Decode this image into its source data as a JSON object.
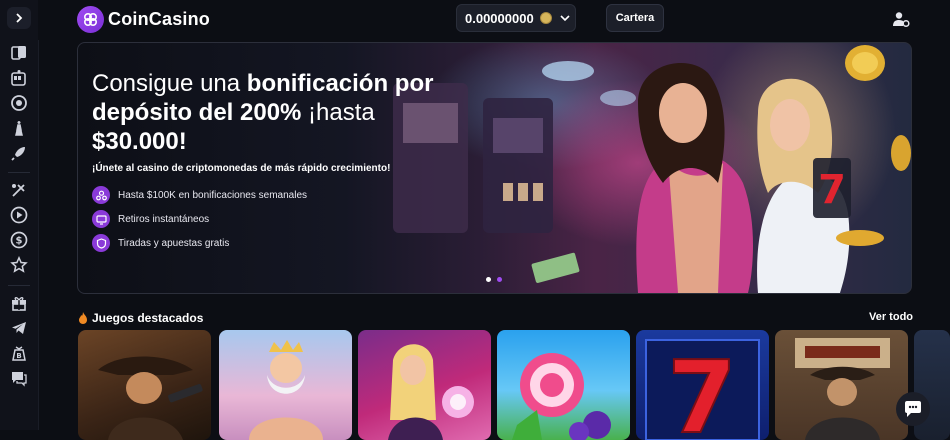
{
  "app": {
    "name": "CoinCasino",
    "brand_color": "#a04cf2"
  },
  "header": {
    "balance": "0.00000000",
    "coin_icon": "coin-icon",
    "wallet_label": "Cartera",
    "user_icon": "user-settings-icon"
  },
  "sidebar": {
    "toggle_icon": "chevron-right-icon",
    "items": [
      {
        "icon": "cards-icon"
      },
      {
        "icon": "slot-machine-icon"
      },
      {
        "icon": "roulette-icon"
      },
      {
        "icon": "chess-icon"
      },
      {
        "icon": "rocket-icon"
      },
      {
        "icon": "sports-icon"
      },
      {
        "icon": "play-icon"
      },
      {
        "icon": "dollar-icon"
      },
      {
        "icon": "star-icon"
      },
      {
        "icon": "gift-icon"
      },
      {
        "icon": "telegram-icon"
      },
      {
        "icon": "bitcoin-bag-icon"
      },
      {
        "icon": "support-icon"
      }
    ]
  },
  "banner": {
    "headline_part1": "Consigue una ",
    "headline_bold1": "bonificación por depósito del 200%",
    "headline_part2": " ¡hasta ",
    "headline_bold2": "$30.000!",
    "subline": "¡Únete al casino de criptomonedas de más rápido crecimiento!",
    "perks": [
      {
        "icon": "users-icon",
        "text": "Hasta $100K en bonificaciones semanales"
      },
      {
        "icon": "screen-icon",
        "text": "Retiros instantáneos"
      },
      {
        "icon": "shield-icon",
        "text": "Tiradas y apuestas gratis"
      }
    ],
    "slides_total": 2,
    "slides_active": 2
  },
  "featured": {
    "title": "Juegos destacados",
    "title_icon": "fire-icon",
    "see_all": "Ver todo",
    "games": [
      {
        "image": "cowboy-gunslinger-thumbnail"
      },
      {
        "image": "zeus-thumbnail"
      },
      {
        "image": "sorceress-thumbnail"
      },
      {
        "image": "candy-lollipop-thumbnail"
      },
      {
        "image": "lucky-seven-thumbnail"
      },
      {
        "image": "wanted-bandit-thumbnail"
      }
    ]
  },
  "chat_icon": "chat-bubble-icon"
}
